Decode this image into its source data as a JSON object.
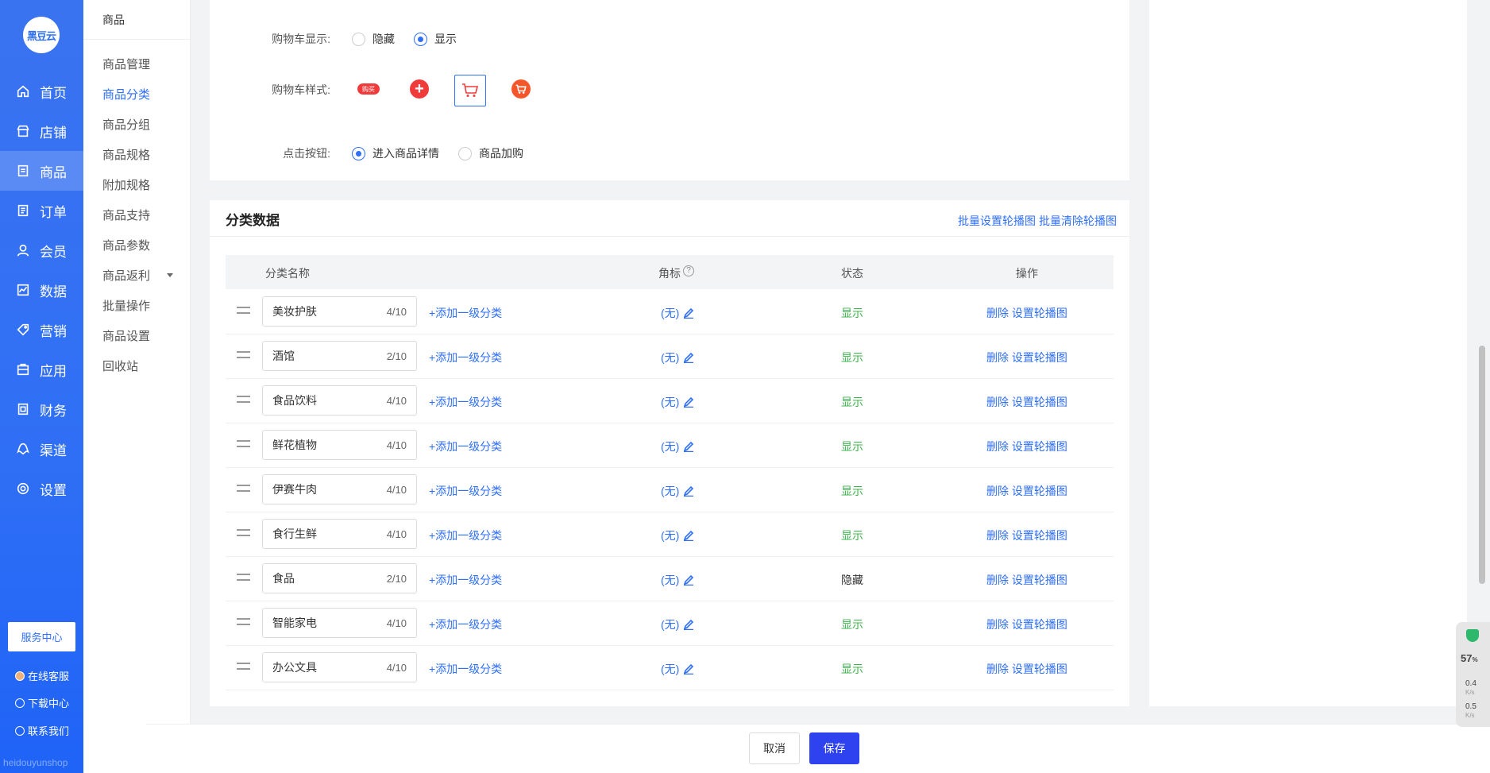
{
  "nav": {
    "logo": "黑豆云",
    "items": [
      {
        "label": "首页",
        "icon": "home-icon"
      },
      {
        "label": "店铺",
        "icon": "store-icon"
      },
      {
        "label": "商品",
        "icon": "goods-icon"
      },
      {
        "label": "订单",
        "icon": "order-icon"
      },
      {
        "label": "会员",
        "icon": "member-icon"
      },
      {
        "label": "数据",
        "icon": "chart-icon"
      },
      {
        "label": "营销",
        "icon": "tag-icon"
      },
      {
        "label": "应用",
        "icon": "app-icon"
      },
      {
        "label": "财务",
        "icon": "finance-icon"
      },
      {
        "label": "渠道",
        "icon": "channel-icon"
      },
      {
        "label": "设置",
        "icon": "gear-icon"
      }
    ],
    "service_center": "服务中心",
    "online_service": "在线客服",
    "download_center": "下载中心",
    "contact_us": "联系我们",
    "watermark": "heidouyunshop"
  },
  "submenu": {
    "title": "商品",
    "items": [
      "商品管理",
      "商品分类",
      "商品分组",
      "商品规格",
      "附加规格",
      "商品支持",
      "商品参数",
      "商品返利",
      "批量操作",
      "商品设置",
      "回收站"
    ],
    "active": "商品分类"
  },
  "form": {
    "cart_display_label": "购物车显示:",
    "cart_display_options": [
      "隐藏",
      "显示"
    ],
    "cart_display_selected": "显示",
    "cart_style_label": "购物车样式:",
    "cart_style_buy_text": "购买",
    "click_button_label": "点击按钮:",
    "click_button_options": [
      "进入商品详情",
      "商品加购"
    ],
    "click_button_selected": "进入商品详情"
  },
  "category": {
    "title": "分类数据",
    "batch_set": "批量设置轮播图",
    "batch_clear": "批量清除轮播图",
    "columns": [
      "分类名称",
      "角标",
      "状态",
      "操作"
    ],
    "help_icon": "?",
    "rows": [
      {
        "name": "美妆护肤",
        "count": "4/10",
        "add": "+添加一级分类",
        "badge": "(无)",
        "status": "显示",
        "del": "删除",
        "set": "设置轮播图"
      },
      {
        "name": "酒馆",
        "count": "2/10",
        "add": "+添加一级分类",
        "badge": "(无)",
        "status": "显示",
        "del": "删除",
        "set": "设置轮播图"
      },
      {
        "name": "食品饮料",
        "count": "4/10",
        "add": "+添加一级分类",
        "badge": "(无)",
        "status": "显示",
        "del": "删除",
        "set": "设置轮播图"
      },
      {
        "name": "鲜花植物",
        "count": "4/10",
        "add": "+添加一级分类",
        "badge": "(无)",
        "status": "显示",
        "del": "删除",
        "set": "设置轮播图"
      },
      {
        "name": "伊赛牛肉",
        "count": "4/10",
        "add": "+添加一级分类",
        "badge": "(无)",
        "status": "显示",
        "del": "删除",
        "set": "设置轮播图"
      },
      {
        "name": "食行生鲜",
        "count": "4/10",
        "add": "+添加一级分类",
        "badge": "(无)",
        "status": "显示",
        "del": "删除",
        "set": "设置轮播图"
      },
      {
        "name": "食品",
        "count": "2/10",
        "add": "+添加一级分类",
        "badge": "(无)",
        "status": "隐藏",
        "del": "删除",
        "set": "设置轮播图"
      },
      {
        "name": "智能家电",
        "count": "4/10",
        "add": "+添加一级分类",
        "badge": "(无)",
        "status": "显示",
        "del": "删除",
        "set": "设置轮播图"
      },
      {
        "name": "办公文具",
        "count": "4/10",
        "add": "+添加一级分类",
        "badge": "(无)",
        "status": "显示",
        "del": "删除",
        "set": "设置轮播图"
      }
    ]
  },
  "footer": {
    "cancel": "取消",
    "save": "保存"
  },
  "widget": {
    "percent": "57",
    "percent_unit": "%",
    "up": "0.4",
    "down": "0.5",
    "unit": "K/s"
  },
  "colors": {
    "primary": "#2f6ff5",
    "save_button": "#2f42f0",
    "status_on": "#3cb44b",
    "cart_red": "#f13b3b"
  }
}
